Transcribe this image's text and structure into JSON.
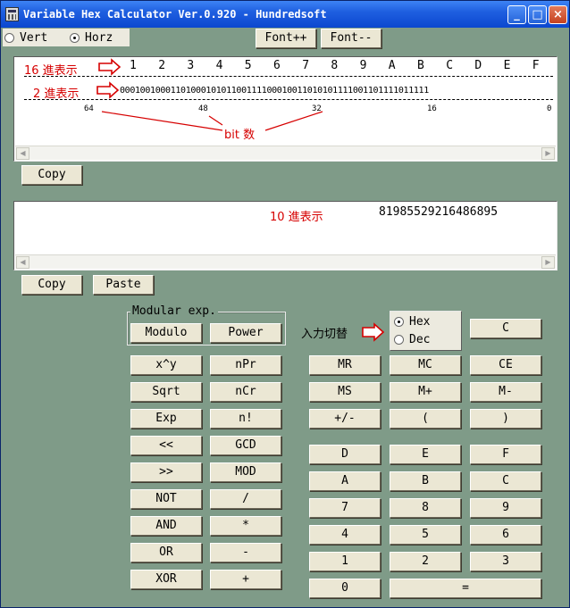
{
  "window": {
    "title": "Variable Hex Calculator Ver.0.920 - Hundredsoft",
    "controls": {
      "minimize": "_",
      "maximize": "□",
      "close": "×"
    }
  },
  "layout_options": {
    "vert_label": "Vert",
    "horz_label": "Horz",
    "selected": "Horz",
    "font_plus": "Font++",
    "font_minus": "Font--"
  },
  "hex_panel": {
    "hex_digits": [
      "1",
      "2",
      "3",
      "4",
      "5",
      "6",
      "7",
      "8",
      "9",
      "A",
      "B",
      "C",
      "D",
      "E",
      "F"
    ],
    "binary": "0001001000110100010101100111100010011010101111001101111011111",
    "bit_ticks": [
      "64",
      "48",
      "32",
      "16",
      "0"
    ],
    "annotations": {
      "hex_label": "16 進表示",
      "bin_label": "2 進表示",
      "bits_label": "bit 数"
    }
  },
  "copy_top": "Copy",
  "dec_panel": {
    "value": "81985529216486895",
    "annotation": "10 進表示"
  },
  "copy_bottom": "Copy",
  "paste": "Paste",
  "modular": {
    "group_label": "Modular exp.",
    "modulo": "Modulo",
    "power": "Power"
  },
  "input_mode": {
    "annotation": "入力切替",
    "hex_label": "Hex",
    "dec_label": "Dec",
    "selected": "Hex"
  },
  "keys": {
    "C": "C",
    "xy": "x^y",
    "npr": "nPr",
    "mr": "MR",
    "mc": "MC",
    "ce": "CE",
    "sqrt": "Sqrt",
    "ncr": "nCr",
    "ms": "MS",
    "mplus": "M+",
    "mminus": "M-",
    "exp": "Exp",
    "fact": "n!",
    "sign": "+/-",
    "lparen": "(",
    "rparen": ")",
    "shl": "<<",
    "gcd": "GCD",
    "D": "D",
    "E": "E",
    "F": "F",
    "shr": ">>",
    "mod": "MOD",
    "A": "A",
    "B": "B",
    "C2": "C",
    "not": "NOT",
    "div": "/",
    "n7": "7",
    "n8": "8",
    "n9": "9",
    "and": "AND",
    "mul": "*",
    "n4": "4",
    "n5": "5",
    "n6": "6",
    "or": "OR",
    "sub": "-",
    "n1": "1",
    "n2": "2",
    "n3": "3",
    "xor": "XOR",
    "add": "+",
    "n0": "0",
    "eq": "="
  },
  "colors": {
    "bg": "#7f9b88",
    "button": "#ebe7d4",
    "title_blue": "#0b47cf",
    "annotation_red": "#d60000"
  }
}
